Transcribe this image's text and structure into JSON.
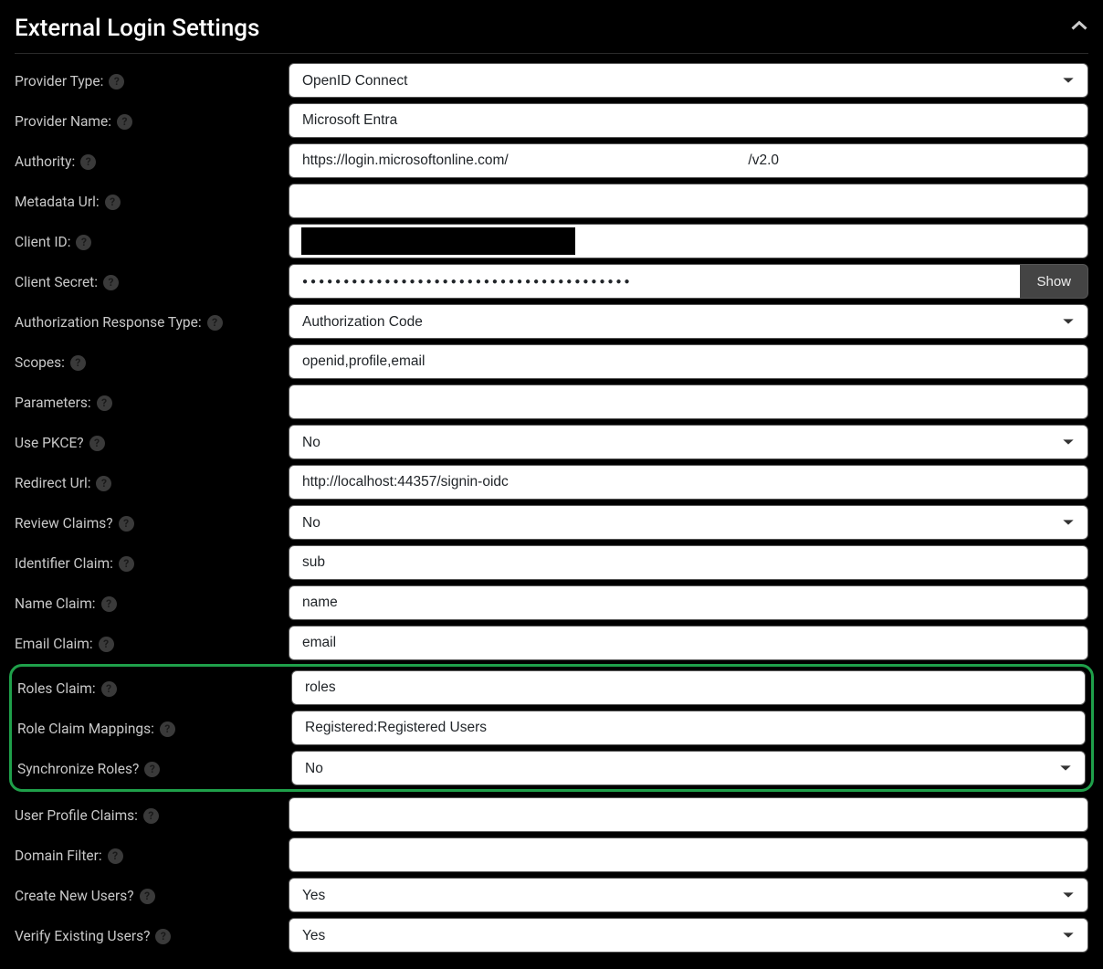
{
  "panel": {
    "title": "External Login Settings"
  },
  "labels": {
    "provider_type": "Provider Type:",
    "provider_name": "Provider Name:",
    "authority": "Authority:",
    "metadata_url": "Metadata Url:",
    "client_id": "Client ID:",
    "client_secret": "Client Secret:",
    "auth_response_type": "Authorization Response Type:",
    "scopes": "Scopes:",
    "parameters": "Parameters:",
    "use_pkce": "Use PKCE?",
    "redirect_url": "Redirect Url:",
    "review_claims": "Review Claims?",
    "identifier_claim": "Identifier Claim:",
    "name_claim": "Name Claim:",
    "email_claim": "Email Claim:",
    "roles_claim": "Roles Claim:",
    "role_claim_mappings": "Role Claim Mappings:",
    "synchronize_roles": "Synchronize Roles?",
    "user_profile_claims": "User Profile Claims:",
    "domain_filter": "Domain Filter:",
    "create_new_users": "Create New Users?",
    "verify_existing_users": "Verify Existing Users?"
  },
  "values": {
    "provider_type": "OpenID Connect",
    "provider_name": "Microsoft Entra",
    "authority": "https://login.microsoftonline.com/                                                             /v2.0",
    "metadata_url": "",
    "client_id": "",
    "client_secret_mask": "●●●●●●●●●●●●●●●●●●●●●●●●●●●●●●●●●●●●●●●●",
    "auth_response_type": "Authorization Code",
    "scopes": "openid,profile,email",
    "parameters": "",
    "use_pkce": "No",
    "redirect_url": "http://localhost:44357/signin-oidc",
    "review_claims": "No",
    "identifier_claim": "sub",
    "name_claim": "name",
    "email_claim": "email",
    "roles_claim": "roles",
    "role_claim_mappings": "Registered:Registered Users",
    "synchronize_roles": "No",
    "user_profile_claims": "",
    "domain_filter": "",
    "create_new_users": "Yes",
    "verify_existing_users": "Yes"
  },
  "buttons": {
    "show": "Show"
  }
}
